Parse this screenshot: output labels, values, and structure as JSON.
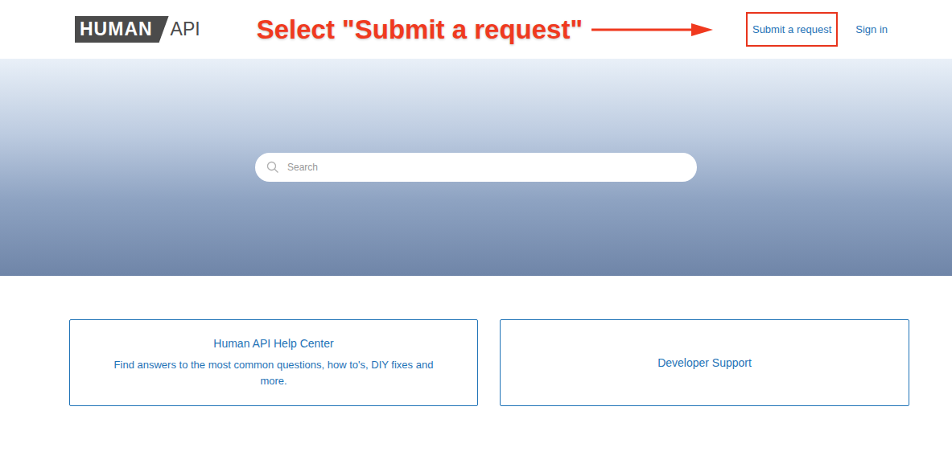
{
  "logo": {
    "primary": "HUMAN",
    "secondary": "API"
  },
  "annotation": {
    "text": "Select \"Submit a request\""
  },
  "nav": [
    {
      "label": "Submit a request",
      "highlighted": true
    },
    {
      "label": "Sign in",
      "highlighted": false
    }
  ],
  "search": {
    "placeholder": "Search"
  },
  "cards": [
    {
      "title": "Human API Help Center",
      "description": "Find answers to the most common questions, how to's, DIY fixes and more."
    },
    {
      "title": "Developer Support"
    }
  ]
}
